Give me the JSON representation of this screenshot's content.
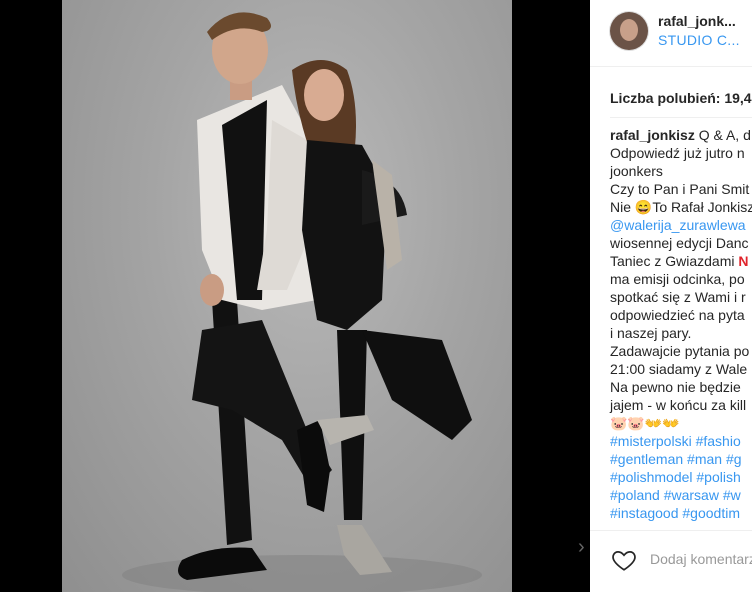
{
  "post": {
    "username": "rafal_jonk...",
    "location": "STUDIO C...",
    "likes_label": "Liczba polubień: 19,4",
    "caption_lines": [
      {
        "parts": [
          {
            "t": "rafal_jonkisz",
            "c": "uname"
          },
          {
            "t": " Q & A, d",
            "c": "text"
          }
        ]
      },
      {
        "parts": [
          {
            "t": "Odpowiedź już jutro n",
            "c": "text"
          }
        ]
      },
      {
        "parts": [
          {
            "t": "joonkers",
            "c": "text"
          }
        ]
      },
      {
        "parts": [
          {
            "t": "Czy to Pan i Pani Smit",
            "c": "text"
          }
        ]
      },
      {
        "parts": [
          {
            "t": "Nie 😄To Rafał Jonkisz",
            "c": "text"
          }
        ]
      },
      {
        "parts": [
          {
            "t": "@walerija_zurawlewa",
            "c": "link"
          }
        ]
      },
      {
        "parts": [
          {
            "t": "wiosennej edycji Danc",
            "c": "text"
          }
        ]
      },
      {
        "parts": [
          {
            "t": "Taniec z Gwiazdami ",
            "c": "text"
          },
          {
            "t": "N",
            "c": "red"
          }
        ]
      },
      {
        "parts": [
          {
            "t": "ma emisji odcinka, po",
            "c": "text"
          }
        ]
      },
      {
        "parts": [
          {
            "t": "spotkać się z Wami i r",
            "c": "text"
          }
        ]
      },
      {
        "parts": [
          {
            "t": "odpowiedzieć na pyta",
            "c": "text"
          }
        ]
      },
      {
        "parts": [
          {
            "t": "i naszej pary.",
            "c": "text"
          }
        ]
      },
      {
        "parts": [
          {
            "t": "Zadawajcie pytania po",
            "c": "text"
          }
        ]
      },
      {
        "parts": [
          {
            "t": "21:00 siadamy z Wale",
            "c": "text"
          }
        ]
      },
      {
        "parts": [
          {
            "t": "Na pewno nie będzie",
            "c": "text"
          }
        ]
      },
      {
        "parts": [
          {
            "t": "jajem - w końcu za kill",
            "c": "text"
          }
        ]
      },
      {
        "parts": [
          {
            "t": "🐷🐷👐👐",
            "c": "text"
          }
        ]
      },
      {
        "parts": [
          {
            "t": "#misterpolski #fashio",
            "c": "link"
          }
        ]
      },
      {
        "parts": [
          {
            "t": "#gentleman #man #g",
            "c": "link"
          }
        ]
      },
      {
        "parts": [
          {
            "t": "#polishmodel #polish",
            "c": "link"
          }
        ]
      },
      {
        "parts": [
          {
            "t": "#poland #warsaw #w",
            "c": "link"
          }
        ]
      },
      {
        "parts": [
          {
            "t": "#instagood #goodtim",
            "c": "link"
          }
        ]
      }
    ],
    "comment_placeholder": "Dodaj komentarz"
  },
  "icons": {
    "heart": "heart-outline-icon",
    "carousel": "chevron-icon"
  },
  "colors": {
    "link": "#3897f0",
    "text": "#262626",
    "muted": "#999999",
    "accent_red": "#e0242c"
  }
}
